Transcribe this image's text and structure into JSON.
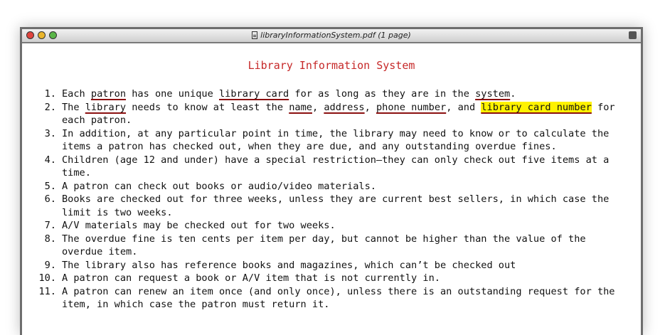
{
  "window": {
    "title": "libraryInformationSystem.pdf (1 page)",
    "controls": [
      "close-icon",
      "minimize-icon",
      "zoom-icon"
    ],
    "colors": {
      "close": "#e0443e",
      "minimize": "#e9b52b",
      "zoom": "#59b548"
    }
  },
  "document": {
    "heading": "Library Information System",
    "heading_color": "#c62828",
    "underline_color": "#8b1010",
    "highlight_color": "#fff200",
    "requirements": [
      {
        "num": "1.",
        "line1_pre": "Each ",
        "t_patron": "patron",
        "line1_mid": " has one unique ",
        "t_card": "library card",
        "line1_mid2": " for as long as they are in the ",
        "t_system": "system",
        "line1_end": "."
      },
      {
        "num": "2.",
        "pre": "The ",
        "t_library": "library",
        "mid": " needs to know at least the ",
        "t_name": "name",
        "c1": ", ",
        "t_address": "address",
        "c2": ", ",
        "t_phone": "phone number",
        "c3": ", and ",
        "t_cardnum": "library card number",
        "end": " for",
        "line2": "each patron."
      },
      {
        "num": "3.",
        "line1": "In addition, at any particular point in time, the library may need to know or to calculate the",
        "line2": "items a patron has checked out, when they are due, and any outstanding overdue fines."
      },
      {
        "num": "4.",
        "line1": "Children (age 12 and under) have a special restriction—they can only check out five items at a",
        "line2": "time."
      },
      {
        "num": "5.",
        "line1": "A patron can check out books or audio/video materials."
      },
      {
        "num": "6.",
        "line1": "Books are checked out for three weeks, unless they are current best sellers, in which case the",
        "line2": "limit is two weeks."
      },
      {
        "num": "7.",
        "line1": "A/V materials may be checked out for two weeks."
      },
      {
        "num": "8.",
        "line1": "The overdue fine is ten cents per item per day, but cannot be higher than the value of the",
        "line2": "overdue item."
      },
      {
        "num": "9.",
        "line1": "The library also has reference books and magazines, which can’t be checked out"
      },
      {
        "num": "10.",
        "line1": "A patron can request a book or A/V item that is not currently in."
      },
      {
        "num": "11.",
        "line1": "A patron can renew an item once (and only once), unless there is an outstanding request for the",
        "line2": "item, in which case the patron must return it."
      }
    ]
  }
}
